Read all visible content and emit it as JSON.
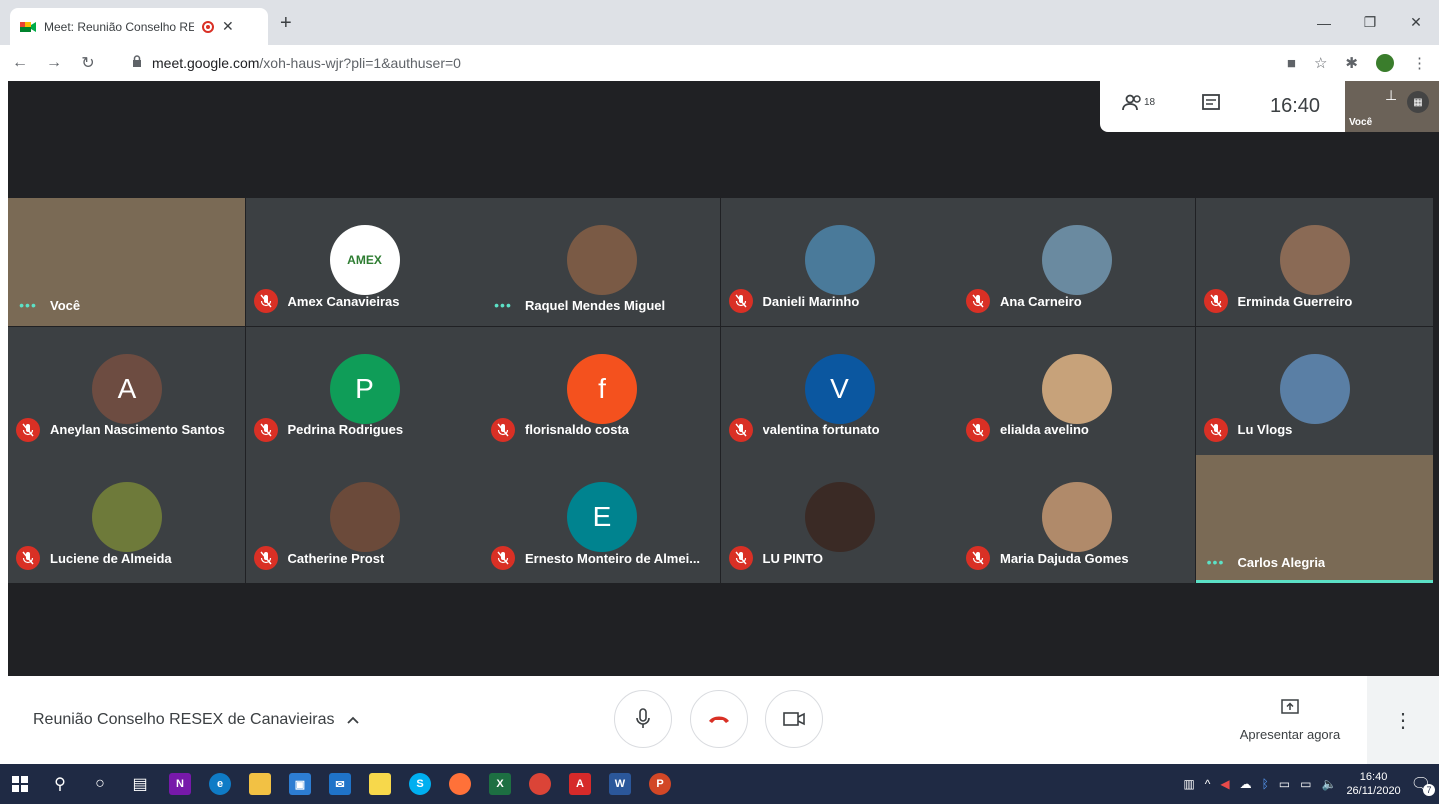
{
  "browser": {
    "tab_title": "Meet: Reunião Conselho RES",
    "url_host": "meet.google.com",
    "url_path": "/xoh-haus-wjr?pli=1&authuser=0"
  },
  "meet": {
    "participant_count": "18",
    "clock": "16:40",
    "self_label": "Você",
    "meeting_title": "Reunião Conselho RESEX de Canavieiras",
    "present_label": "Apresentar agora",
    "participants": [
      {
        "name": "Você",
        "status": "speaking",
        "kind": "video",
        "initial": ""
      },
      {
        "name": "Amex Canavieiras",
        "status": "muted",
        "kind": "logo",
        "initial": "AMEX"
      },
      {
        "name": "Raquel Mendes Miguel",
        "status": "speaking",
        "kind": "photo",
        "initial": ""
      },
      {
        "name": "Danieli Marinho",
        "status": "muted",
        "kind": "photo",
        "initial": ""
      },
      {
        "name": "Ana Carneiro",
        "status": "muted",
        "kind": "photo",
        "initial": ""
      },
      {
        "name": "Erminda Guerreiro",
        "status": "muted",
        "kind": "photo",
        "initial": ""
      },
      {
        "name": "Aneylan Nascimento Santos",
        "status": "muted",
        "kind": "letter",
        "initial": "A"
      },
      {
        "name": "Pedrina Rodrigues",
        "status": "muted",
        "kind": "letter",
        "initial": "P"
      },
      {
        "name": "florisnaldo costa",
        "status": "muted",
        "kind": "letter",
        "initial": "f"
      },
      {
        "name": "valentina fortunato",
        "status": "muted",
        "kind": "letter",
        "initial": "V"
      },
      {
        "name": "elialda avelino",
        "status": "muted",
        "kind": "photo",
        "initial": ""
      },
      {
        "name": "Lu Vlogs",
        "status": "muted",
        "kind": "photo",
        "initial": ""
      },
      {
        "name": "Luciene de Almeida",
        "status": "muted",
        "kind": "photo",
        "initial": ""
      },
      {
        "name": "Catherine Prost",
        "status": "muted",
        "kind": "photo",
        "initial": ""
      },
      {
        "name": "Ernesto Monteiro de Almei...",
        "status": "muted",
        "kind": "letter",
        "initial": "E"
      },
      {
        "name": "LU PINTO",
        "status": "muted",
        "kind": "photo",
        "initial": ""
      },
      {
        "name": "Maria Dajuda Gomes",
        "status": "muted",
        "kind": "photo",
        "initial": ""
      },
      {
        "name": "Carlos Alegria",
        "status": "speaking",
        "kind": "video",
        "initial": ""
      }
    ]
  },
  "taskbar": {
    "time": "16:40",
    "date": "26/11/2020",
    "notifications": "7"
  },
  "colors": {
    "meet_bg": "#202124",
    "tile_bg": "#3c4043",
    "mute_red": "#d93025",
    "avatar_A": "#6d4c41",
    "avatar_P": "#0f9d58",
    "avatar_f": "#f4511e",
    "avatar_V": "#0b57a0",
    "avatar_E": "#00838f",
    "speaking_accent": "#5ce1c6"
  }
}
